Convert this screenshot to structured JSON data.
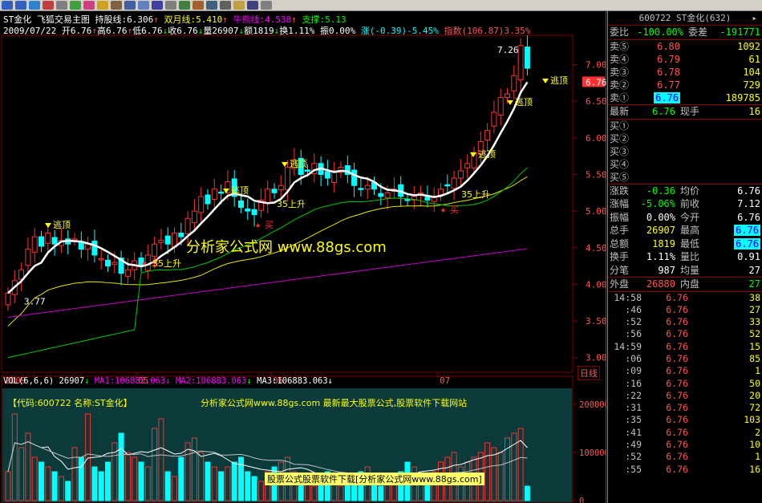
{
  "toolbar": {
    "icons": [
      "back-icon",
      "forward-icon",
      "grid-icon",
      "stock-icon",
      "tools-icon",
      "chart-icon",
      "heart-icon",
      "alert-icon",
      "draw-icon",
      "list-icon",
      "window-icon",
      "info-icon",
      "doc-icon",
      "table-icon",
      "arrange-icon",
      "search-icon",
      "print-icon",
      "f10-icon",
      "save-icon",
      "dropdown-icon"
    ]
  },
  "chart": {
    "header1": {
      "stock": "ST金化",
      "formula": "飞狐交易主图",
      "hold_label": "持股线:",
      "hold_value": "6.306",
      "double_label": "双月线:",
      "double_value": "5.410",
      "bull_label": "牛熊线:",
      "bull_value": "4.538",
      "support_label": "支撑:",
      "support_value": "5.13"
    },
    "header2": {
      "date": "2009/07/22",
      "open": "开6.76",
      "high": "高6.76",
      "low": "低6.76",
      "close": "收6.76",
      "vol": "量26907",
      "amt": "额1819",
      "turn": "换1.11%",
      "amp": "振0.00%",
      "chg": "涨(-0.39)-5.45%",
      "index": "指数(106.87)3.35%"
    },
    "watermark": "分析家公式网 www.88gs.com",
    "price_axis": [
      "7.00",
      "6.50",
      "6.00",
      "5.50",
      "5.00",
      "4.50",
      "4.00",
      "3.50",
      "3.00"
    ],
    "current_price_tag": "6.76",
    "high_label": "7.26",
    "low_label": "3.77",
    "date_axis": [
      "2009",
      "05",
      "06",
      "07"
    ],
    "period_btn": "日线",
    "signals": {
      "escape": "逃顶",
      "buy": "买",
      "rise": "35上升"
    },
    "vol_header": {
      "vol": "VOL(6,6,6)",
      "v": "26907",
      "ma1": "MA1:106883.063",
      "ma2": "MA2:106883.063",
      "ma3": "MA3:106883.063"
    },
    "vol_axis": [
      "200000",
      "100000",
      "0"
    ],
    "vol_info": {
      "code": "【代码:600722 名称:ST金化】",
      "promo": "分析家公式网www.88gs.com 最新最大股票公式,股票软件下载网站",
      "bottom": "股票公式股票软件下载[分析家公式网www.88gs.com]"
    }
  },
  "chart_data": {
    "type": "candlestick",
    "title": "",
    "ylim": [
      2.8,
      7.4
    ],
    "candles_close": [
      3.88,
      4.05,
      4.2,
      4.48,
      4.65,
      4.52,
      4.7,
      4.55,
      4.6,
      4.55,
      4.62,
      4.48,
      4.55,
      4.4,
      4.35,
      4.25,
      4.3,
      4.15,
      4.2,
      4.32,
      4.25,
      4.4,
      4.55,
      4.6,
      4.55,
      4.7,
      4.65,
      4.9,
      5.0,
      5.2,
      5.1,
      5.3,
      5.25,
      5.4,
      5.2,
      5.05,
      5.0,
      4.95,
      5.15,
      5.3,
      5.25,
      5.35,
      5.6,
      5.7,
      5.5,
      5.55,
      5.65,
      5.5,
      5.45,
      5.55,
      5.6,
      5.5,
      5.35,
      5.3,
      5.35,
      5.3,
      5.2,
      5.25,
      5.3,
      5.2,
      5.15,
      5.2,
      5.25,
      5.15,
      5.2,
      5.3,
      5.35,
      5.45,
      5.55,
      5.65,
      5.8,
      5.95,
      6.1,
      6.35,
      6.55,
      6.6,
      6.85,
      7.26,
      6.95
    ],
    "vol_values": [
      60,
      180,
      110,
      140,
      90,
      80,
      70,
      60,
      50,
      40,
      110,
      90,
      180,
      70,
      60,
      80,
      120,
      140,
      100,
      90,
      80,
      70,
      150,
      170,
      60,
      50,
      90,
      120,
      130,
      100,
      80,
      70,
      60,
      70,
      80,
      90,
      60,
      50,
      40,
      60,
      70,
      80,
      90,
      60,
      50,
      40,
      30,
      50,
      60,
      40,
      30,
      40,
      50,
      60,
      70,
      40,
      30,
      40,
      50,
      60,
      80,
      70,
      60,
      50,
      60,
      80,
      90,
      100,
      70,
      80,
      90,
      100,
      120,
      110,
      100,
      130,
      140,
      150,
      30
    ]
  },
  "panel": {
    "title": "600722 ST金化(632)",
    "weibi": {
      "l1": "委比",
      "v1": "-100.00%",
      "l2": "委差",
      "v2": "-191771"
    },
    "sells": [
      {
        "label": "卖⑤",
        "price": "6.80",
        "vol": "1092"
      },
      {
        "label": "卖④",
        "price": "6.79",
        "vol": "61"
      },
      {
        "label": "卖③",
        "price": "6.78",
        "vol": "104"
      },
      {
        "label": "卖②",
        "price": "6.77",
        "vol": "729"
      },
      {
        "label": "卖①",
        "price": "6.76",
        "vol": "189785"
      }
    ],
    "latest": {
      "l1": "最新",
      "v1": "6.76",
      "l2": "现手",
      "v2": "16"
    },
    "buys": [
      "买①",
      "买②",
      "买③",
      "买④",
      "买⑤"
    ],
    "stats": [
      {
        "l1": "涨跌",
        "v1": "-0.36",
        "l2": "均价",
        "v2": "6.76"
      },
      {
        "l1": "涨幅",
        "v1": "-5.06%",
        "l2": "前收",
        "v2": "7.12"
      },
      {
        "l1": "振幅",
        "v1": "0.00%",
        "l2": "今开",
        "v2": "6.76"
      },
      {
        "l1": "总手",
        "v1": "26907",
        "l2": "最高",
        "v2": "6.76"
      },
      {
        "l1": "总额",
        "v1": "1819",
        "l2": "最低",
        "v2": "6.76"
      },
      {
        "l1": "换手",
        "v1": "1.11%",
        "l2": "量比",
        "v2": "0.91"
      },
      {
        "l1": "分笔",
        "v1": "987",
        "l2": "均量",
        "v2": "27"
      }
    ],
    "outer": {
      "l1": "外盘",
      "v1": "26880",
      "l2": "内盘",
      "v2": "27"
    },
    "ticks": [
      {
        "t": "14:58",
        "p": "6.76",
        "v": "38"
      },
      {
        "t": ":46",
        "p": "6.76",
        "v": "27"
      },
      {
        "t": ":52",
        "p": "6.76",
        "v": "33"
      },
      {
        "t": ":56",
        "p": "6.76",
        "v": "52"
      },
      {
        "t": "14:59",
        "p": "6.76",
        "v": "15"
      },
      {
        "t": ":06",
        "p": "6.76",
        "v": "85"
      },
      {
        "t": ":09",
        "p": "6.76",
        "v": "1"
      },
      {
        "t": ":16",
        "p": "6.76",
        "v": "50"
      },
      {
        "t": ":22",
        "p": "6.76",
        "v": "20"
      },
      {
        "t": ":31",
        "p": "6.76",
        "v": "72"
      },
      {
        "t": ":35",
        "p": "6.76",
        "v": "103"
      },
      {
        "t": ":41",
        "p": "6.76",
        "v": "2"
      },
      {
        "t": ":49",
        "p": "6.76",
        "v": "10"
      },
      {
        "t": ":52",
        "p": "6.76",
        "v": "1"
      },
      {
        "t": ":55",
        "p": "6.76",
        "v": "16"
      }
    ]
  },
  "colors": {
    "up": "#ff3232",
    "down": "#00ffff",
    "ma_white": "#ffffff",
    "ma_yellow": "#e6e600",
    "ma_green": "#00c800",
    "ma_magenta": "#c800c8",
    "frame": "#800000"
  }
}
